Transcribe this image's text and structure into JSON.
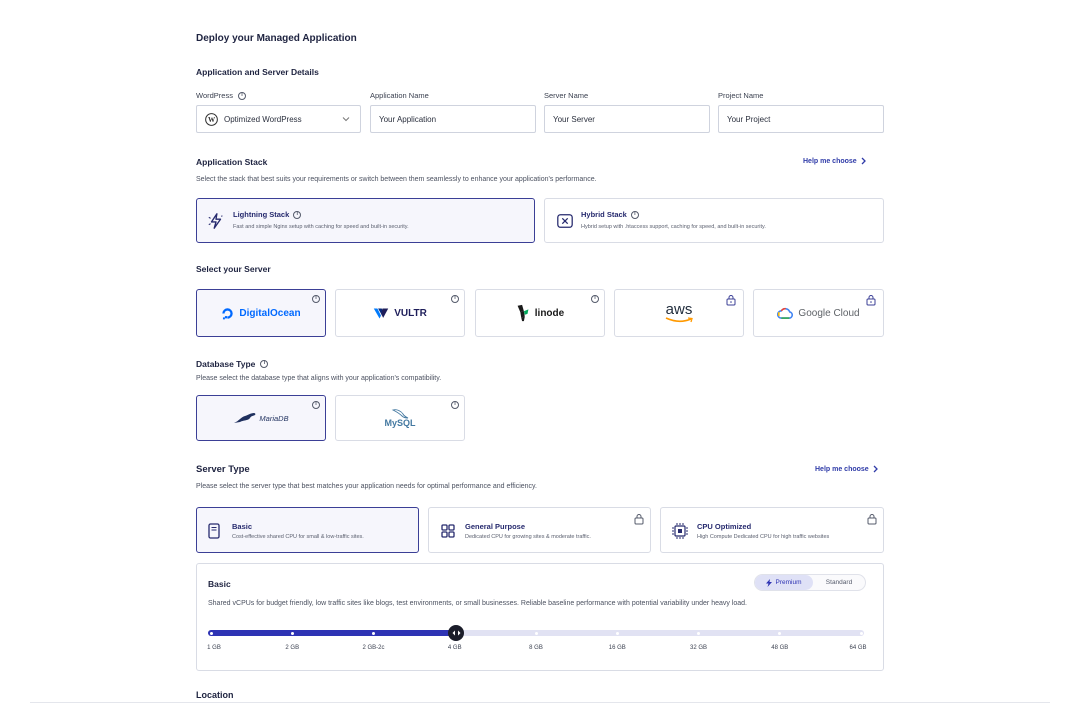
{
  "page_title": "Deploy your Managed Application",
  "app_server": {
    "title": "Application and Server Details",
    "wordpress_label": "WordPress",
    "wordpress_value": "Optimized WordPress",
    "app_name_label": "Application Name",
    "app_name_value": "Your Application",
    "server_name_label": "Server Name",
    "server_name_value": "Your Server",
    "project_name_label": "Project Name",
    "project_name_value": "Your Project"
  },
  "stack": {
    "title": "Application Stack",
    "help": "Help me choose",
    "description": "Select the stack that best suits your requirements or switch between them seamlessly to enhance your application's performance.",
    "options": [
      {
        "title": "Lightning Stack",
        "desc": "Fast and simple Nginx setup with caching for speed and built-in security.",
        "selected": true
      },
      {
        "title": "Hybrid Stack",
        "desc": "Hybrid setup with .htaccess support, caching for speed, and built-in security.",
        "selected": false
      }
    ]
  },
  "server": {
    "title": "Select your Server",
    "providers": [
      {
        "name": "DigitalOcean",
        "icon": "digitalocean-logo",
        "color": "#0069ff",
        "locked": false,
        "selected": true
      },
      {
        "name": "VULTR",
        "icon": "vultr-logo",
        "color": "#1e1e5a",
        "locked": false,
        "selected": false
      },
      {
        "name": "linode",
        "icon": "linode-logo",
        "color": "#1a1a1a",
        "locked": false,
        "selected": false
      },
      {
        "name": "aws",
        "icon": "aws-logo",
        "color": "#232f3e",
        "locked": true,
        "selected": false
      },
      {
        "name": "Google Cloud",
        "icon": "google-cloud-logo",
        "color": "#5f6368",
        "locked": true,
        "selected": false
      }
    ]
  },
  "database": {
    "title": "Database Type",
    "description": "Please select the database type that aligns with your application's compatibility.",
    "options": [
      {
        "name": "MariaDB",
        "selected": true
      },
      {
        "name": "MySQL",
        "selected": false
      }
    ]
  },
  "server_type": {
    "title": "Server Type",
    "help": "Help me choose",
    "description": "Please select the server type that best matches your application needs for optimal performance and efficiency.",
    "options": [
      {
        "title": "Basic",
        "desc": "Cost-effective shared CPU for small & low-traffic sites.",
        "locked": false,
        "selected": true
      },
      {
        "title": "General Purpose",
        "desc": "Dedicated CPU for growing sites & moderate traffic.",
        "locked": true,
        "selected": false
      },
      {
        "title": "CPU Optimized",
        "desc": "High Compute Dedicated CPU for high traffic websites",
        "locked": true,
        "selected": false
      }
    ]
  },
  "basic_panel": {
    "title": "Basic",
    "toggle_premium": "Premium",
    "toggle_standard": "Standard",
    "description": "Shared vCPUs for budget friendly, low traffic sites like blogs, test environments, or small businesses. Reliable baseline performance with potential variability under heavy load.",
    "sizes": [
      "1 GB",
      "2 GB",
      "2 GB-2c",
      "4 GB",
      "8 GB",
      "16 GB",
      "32 GB",
      "48 GB",
      "64 GB"
    ],
    "selected_index": 3
  },
  "location": {
    "title": "Location"
  },
  "colors": {
    "accent": "#2e33b4",
    "selected_border": "#3b3f96"
  }
}
